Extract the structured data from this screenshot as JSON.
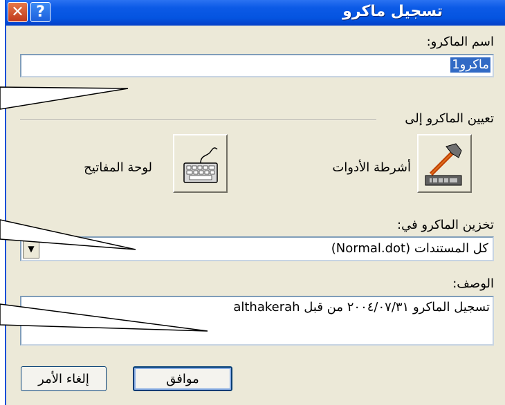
{
  "window": {
    "title": "تسجيل ماكرو",
    "help_glyph": "?",
    "close_glyph": "✕"
  },
  "macro_name": {
    "label": "اسم الماكرو:",
    "value": "ماكرو1"
  },
  "assign": {
    "group_label": "تعيين الماكرو إلى",
    "toolbars_label": "أشرطة الأدوات",
    "keyboard_label": "لوحة المفاتيح"
  },
  "store_in": {
    "label": "تخزين الماكرو في:",
    "selected": "كل المستندات (Normal.dot)"
  },
  "description": {
    "label": "الوصف:",
    "value": "تسجيل الماكرو ٢٠٠٤/٠٧/٣١ من قبل althakerah"
  },
  "buttons": {
    "ok": "موافق",
    "cancel": "إلغاء الأمر"
  },
  "colors": {
    "titlebar": "#0c5ae6",
    "dialog_bg": "#ece9d8",
    "selection": "#316ac5"
  }
}
